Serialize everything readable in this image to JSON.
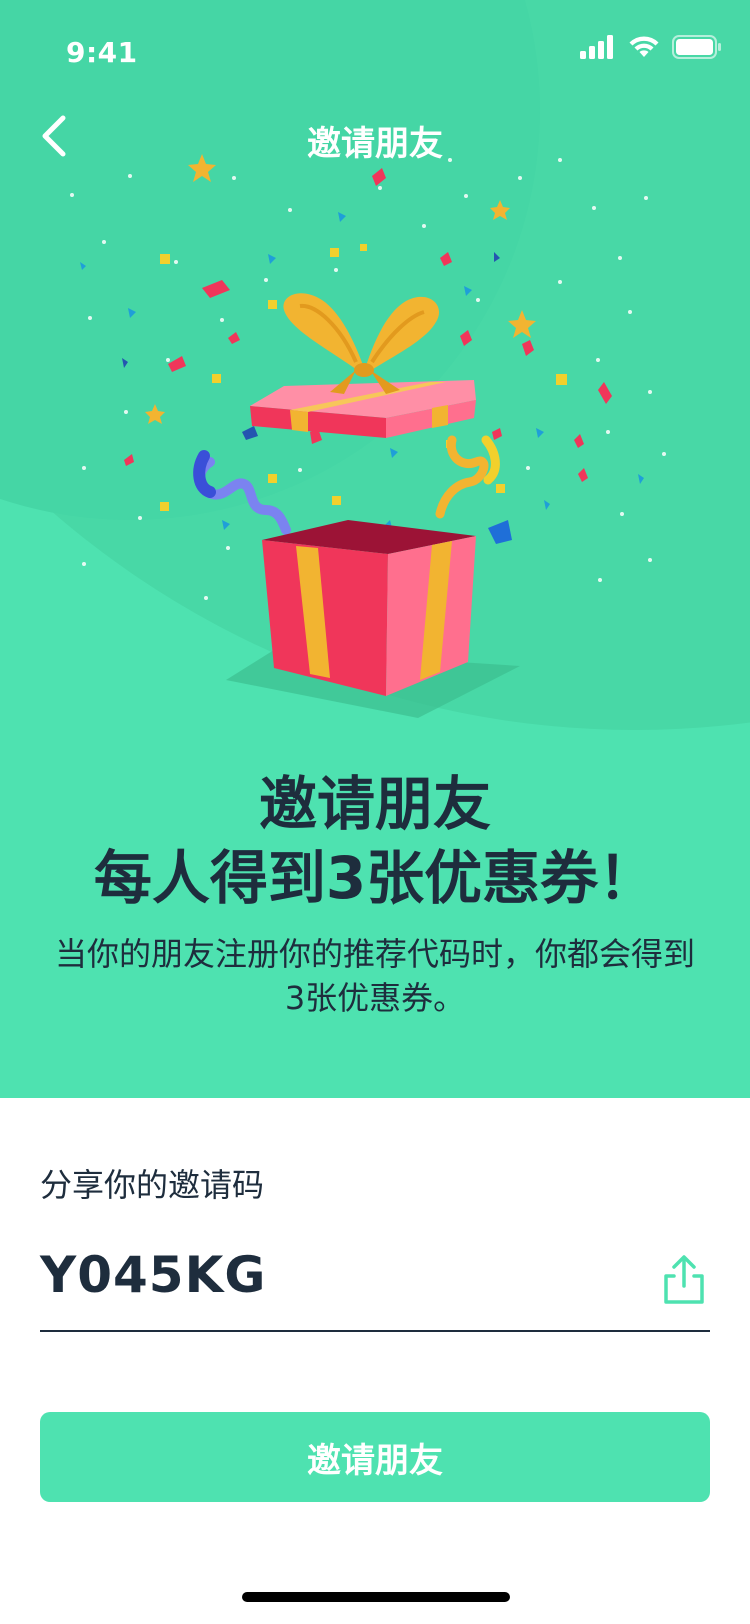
{
  "status_bar": {
    "time": "9:41",
    "icons": [
      "cellular-signal-icon",
      "wifi-icon",
      "battery-icon"
    ]
  },
  "nav": {
    "back_icon": "chevron-left-icon",
    "title": "邀请朋友"
  },
  "hero": {
    "illustration": "gift-box-confetti-illustration",
    "headline_line1": "邀请朋友",
    "headline_line2": "每人得到3张优惠券！",
    "description": "当你的朋友注册你的推荐代码时，你都会得到3张优惠券。"
  },
  "share": {
    "label": "分享你的邀请码",
    "code": "Y045KG",
    "share_icon": "share-upload-icon"
  },
  "invite_button": {
    "label": "邀请朋友"
  },
  "colors": {
    "accent": "#4ee2b0",
    "text_dark": "#1e2d3d",
    "gift_red": "#f0365a",
    "gift_pink": "#ff6f8e",
    "ribbon_gold": "#f2b431"
  }
}
